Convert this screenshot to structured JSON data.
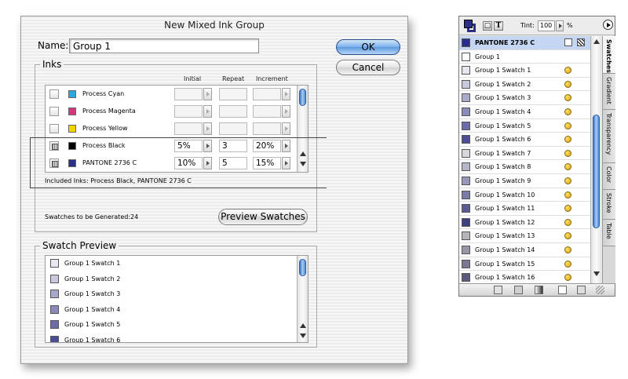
{
  "dialog": {
    "title": "New Mixed Ink Group",
    "name_label": "Name:",
    "name_value": "Group 1",
    "ok_label": "OK",
    "cancel_label": "Cancel",
    "inks_label": "Inks",
    "columns": [
      "Initial",
      "Repeat",
      "Increment"
    ],
    "inks": [
      {
        "name": "Process Cyan",
        "color": "#2aa7dc",
        "checked": false,
        "initial": "",
        "repeat": "",
        "increment": ""
      },
      {
        "name": "Process Magenta",
        "color": "#d5377c",
        "checked": false,
        "initial": "",
        "repeat": "",
        "increment": ""
      },
      {
        "name": "Process Yellow",
        "color": "#f3d400",
        "checked": false,
        "initial": "",
        "repeat": "",
        "increment": ""
      },
      {
        "name": "Process Black",
        "color": "#000000",
        "checked": true,
        "initial": "5%",
        "repeat": "3",
        "increment": "20%"
      },
      {
        "name": "PANTONE 2736 C",
        "color": "#2b2f87",
        "checked": true,
        "initial": "10%",
        "repeat": "5",
        "increment": "15%"
      }
    ],
    "included_inks": "Included Inks: Process Black, PANTONE 2736 C",
    "swatch_count": "Swatches to be Generated:24",
    "preview_button_label": "Preview Swatches",
    "swatch_preview_label": "Swatch Preview",
    "preview_items": [
      {
        "name": "Group 1 Swatch 1",
        "color": "#e8e8f2"
      },
      {
        "name": "Group 1 Swatch 2",
        "color": "#c8c8de"
      },
      {
        "name": "Group 1 Swatch 3",
        "color": "#a8a8cc"
      },
      {
        "name": "Group 1 Swatch 4",
        "color": "#8a8ab8"
      },
      {
        "name": "Group 1 Swatch 5",
        "color": "#6c6ca6"
      },
      {
        "name": "Group 1 Swatch 6",
        "color": "#4c4c94"
      }
    ]
  },
  "panel": {
    "tint_label": "Tint:",
    "tint_value": "100",
    "tint_unit": "%",
    "tabs": [
      "Swatches",
      "Gradient",
      "Transparency",
      "Color",
      "Stroke",
      "Table"
    ],
    "swatches": [
      {
        "name": "PANTONE 2736 C",
        "color": "#2b2f87",
        "selected": true
      },
      {
        "name": "Group 1",
        "color": "#ffffff",
        "selected": false
      },
      {
        "name": "Group 1 Swatch 1",
        "color": "#e6e6f0"
      },
      {
        "name": "Group 1 Swatch 2",
        "color": "#c9c9de"
      },
      {
        "name": "Group 1 Swatch 3",
        "color": "#aaaacd"
      },
      {
        "name": "Group 1 Swatch 4",
        "color": "#8b8bba"
      },
      {
        "name": "Group 1 Swatch 5",
        "color": "#6c6ca8"
      },
      {
        "name": "Group 1 Swatch 6",
        "color": "#4e4e96"
      },
      {
        "name": "Group 1 Swatch 7",
        "color": "#d6d6de"
      },
      {
        "name": "Group 1 Swatch 8",
        "color": "#b6b6ca"
      },
      {
        "name": "Group 1 Swatch 9",
        "color": "#9898b8"
      },
      {
        "name": "Group 1 Swatch 10",
        "color": "#7a7aa6"
      },
      {
        "name": "Group 1 Swatch 11",
        "color": "#5c5c94"
      },
      {
        "name": "Group 1 Swatch 12",
        "color": "#3e3e82"
      },
      {
        "name": "Group 1 Swatch 13",
        "color": "#b4b4bc"
      },
      {
        "name": "Group 1 Swatch 14",
        "color": "#9696a4"
      },
      {
        "name": "Group 1 Swatch 15",
        "color": "#787890"
      },
      {
        "name": "Group 1 Swatch 16",
        "color": "#5a5a7c"
      }
    ]
  }
}
